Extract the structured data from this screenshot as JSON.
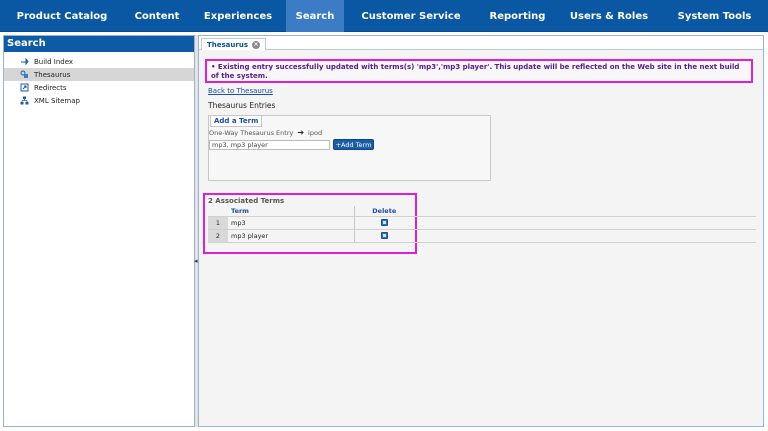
{
  "nav": {
    "items": [
      {
        "label": "Product Catalog",
        "active": false
      },
      {
        "label": "Content",
        "active": false
      },
      {
        "label": "Experiences",
        "active": false
      },
      {
        "label": "Search",
        "active": true
      },
      {
        "label": "Customer Service",
        "active": false
      },
      {
        "label": "Reporting",
        "active": false
      },
      {
        "label": "Users & Roles",
        "active": false
      },
      {
        "label": "System Tools",
        "active": false
      }
    ]
  },
  "sidebar": {
    "title": "Search",
    "items": [
      {
        "label": "Build Index",
        "icon": "build-index-icon",
        "selected": false
      },
      {
        "label": "Thesaurus",
        "icon": "thesaurus-icon",
        "selected": true
      },
      {
        "label": "Redirects",
        "icon": "redirects-icon",
        "selected": false
      },
      {
        "label": "XML Sitemap",
        "icon": "sitemap-icon",
        "selected": false
      }
    ]
  },
  "tab": {
    "label": "Thesaurus"
  },
  "alert": {
    "message": "• Existing entry successfully updated with terms(s) 'mp3','mp3 player'. This update will be reflected on the Web site in the next build of the system."
  },
  "back_link": "Back to Thesaurus",
  "section_title": "Thesaurus Entries",
  "add_term": {
    "title": "Add a Term",
    "entry_label": "One-Way Thesaurus Entry",
    "entry_value": "ipod",
    "input_value": "mp3, mp3 player",
    "button_label": "+Add Term"
  },
  "associated": {
    "title": "2 Associated Terms",
    "col_term": "Term",
    "col_delete": "Delete",
    "rows": [
      {
        "index": "1",
        "term": "mp3"
      },
      {
        "index": "2",
        "term": "mp3 player"
      }
    ]
  },
  "colors": {
    "nav_bg": "#0a57a4",
    "nav_active": "#3b7cc4",
    "highlight": "#e020d0"
  }
}
